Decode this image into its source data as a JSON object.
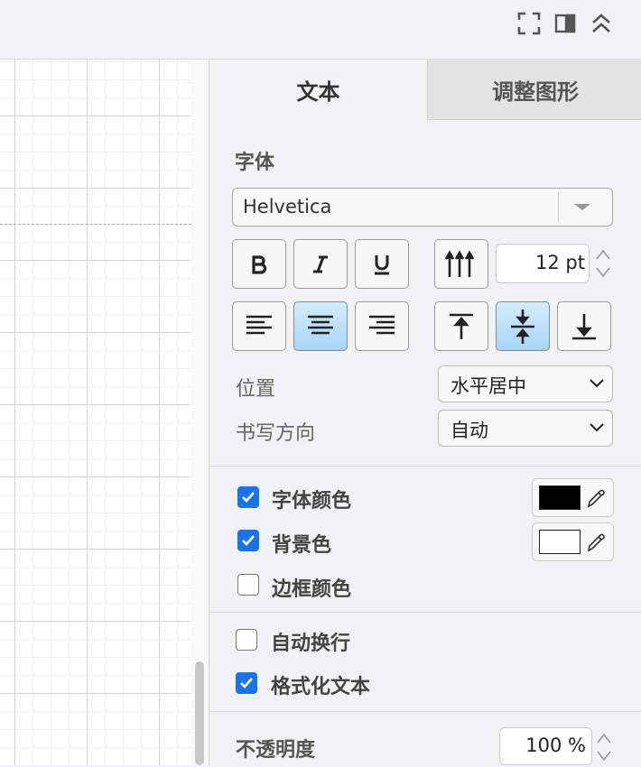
{
  "toolbar": {
    "icons": [
      "fullscreen-icon",
      "format-panel-icon",
      "collapse-icon"
    ]
  },
  "tabs": [
    {
      "label": "文本",
      "active": true
    },
    {
      "label": "调整图形",
      "active": false
    }
  ],
  "font": {
    "section_title": "字体",
    "family": "Helvetica",
    "style_buttons": [
      "bold",
      "italic",
      "underline"
    ],
    "size_value": "12 pt"
  },
  "align": {
    "horizontal_selected": "center",
    "vertical_selected": "middle"
  },
  "position": {
    "label": "位置",
    "value": "水平居中"
  },
  "direction": {
    "label": "书写方向",
    "value": "自动"
  },
  "colors": {
    "font_color": {
      "label": "字体颜色",
      "checked": true,
      "swatch": "#000000"
    },
    "background": {
      "label": "背景色",
      "checked": true,
      "swatch": "#ffffff"
    },
    "border": {
      "label": "边框颜色",
      "checked": false
    }
  },
  "options": {
    "word_wrap": {
      "label": "自动换行",
      "checked": false
    },
    "formatted_text": {
      "label": "格式化文本",
      "checked": true
    }
  },
  "opacity": {
    "label": "不透明度",
    "value": "100 %"
  },
  "accent": "#1a73e8"
}
